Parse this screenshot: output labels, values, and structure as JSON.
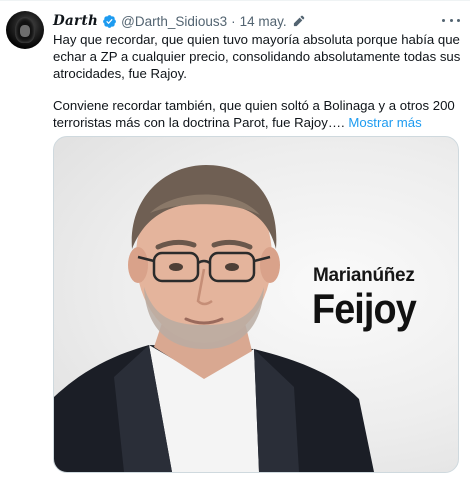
{
  "tweet": {
    "display_name": "Darth",
    "handle": "@Darth_Sidious3",
    "separator": "·",
    "date": "14 may.",
    "paragraphs": [
      "Hay que recordar, que quien tuvo mayoría absoluta porque había que echar a ZP a cualquier precio, consolidando absolutamente todas sus atrocidades, fue Rajoy.",
      "Conviene recordar también, que quien soltó a Bolinaga y a otros 200 terroristas más con la doctrina Parot, fue Rajoy…."
    ],
    "show_more": "Mostrar más"
  },
  "media": {
    "caption_line1": "Marianúñez",
    "caption_line2": "Feijoy"
  },
  "colors": {
    "accent": "#1d9bf0",
    "secondary_text": "#536471",
    "primary_text": "#0f1419"
  },
  "icons": [
    "verified-badge-icon",
    "edit-pencil-icon",
    "more-options-icon"
  ]
}
